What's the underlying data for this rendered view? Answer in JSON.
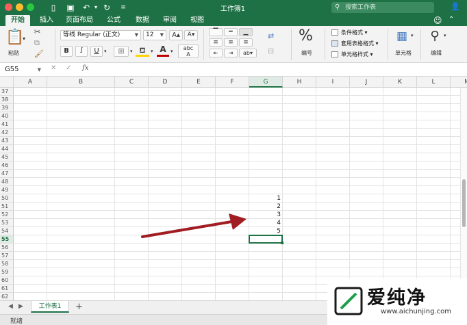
{
  "window": {
    "title": "工作簿1",
    "search_placeholder": "搜索工作表"
  },
  "ribbon_tabs": [
    "开始",
    "插入",
    "页面布局",
    "公式",
    "数据",
    "审阅",
    "视图"
  ],
  "ribbon": {
    "paste_label": "粘贴",
    "font_name": "等线 Regular (正文)",
    "font_size": "12",
    "number_label": "编号",
    "number_glyph": "%",
    "styles": [
      "条件格式",
      "套用表格格式",
      "单元格样式"
    ],
    "cells_label": "单元格",
    "edit_label": "编辑",
    "bold": "B",
    "italic": "I",
    "underline": "U"
  },
  "formula_bar": {
    "name_box": "G55",
    "fx": "fx",
    "content": ""
  },
  "grid": {
    "columns": [
      "A",
      "B",
      "C",
      "D",
      "E",
      "F",
      "G",
      "H",
      "I",
      "J",
      "K",
      "L",
      "M"
    ],
    "rows": [
      "37",
      "38",
      "39",
      "40",
      "41",
      "42",
      "43",
      "44",
      "45",
      "46",
      "47",
      "48",
      "49",
      "50",
      "51",
      "52",
      "53",
      "54",
      "55",
      "56",
      "57",
      "58",
      "59",
      "60",
      "61",
      "62"
    ],
    "selected_column": "G",
    "selected_row": "55",
    "values": [
      {
        "row": "50",
        "col": "G",
        "value": "1"
      },
      {
        "row": "51",
        "col": "G",
        "value": "2"
      },
      {
        "row": "52",
        "col": "G",
        "value": "3"
      },
      {
        "row": "53",
        "col": "G",
        "value": "4"
      },
      {
        "row": "54",
        "col": "G",
        "value": "5"
      }
    ]
  },
  "sheets": [
    "工作表1"
  ],
  "status": "就绪",
  "watermark": {
    "brand": "爱纯净",
    "url": "www.aichunjing.com"
  },
  "colors": {
    "accent": "#1e7145",
    "arrow": "#a01d22"
  }
}
